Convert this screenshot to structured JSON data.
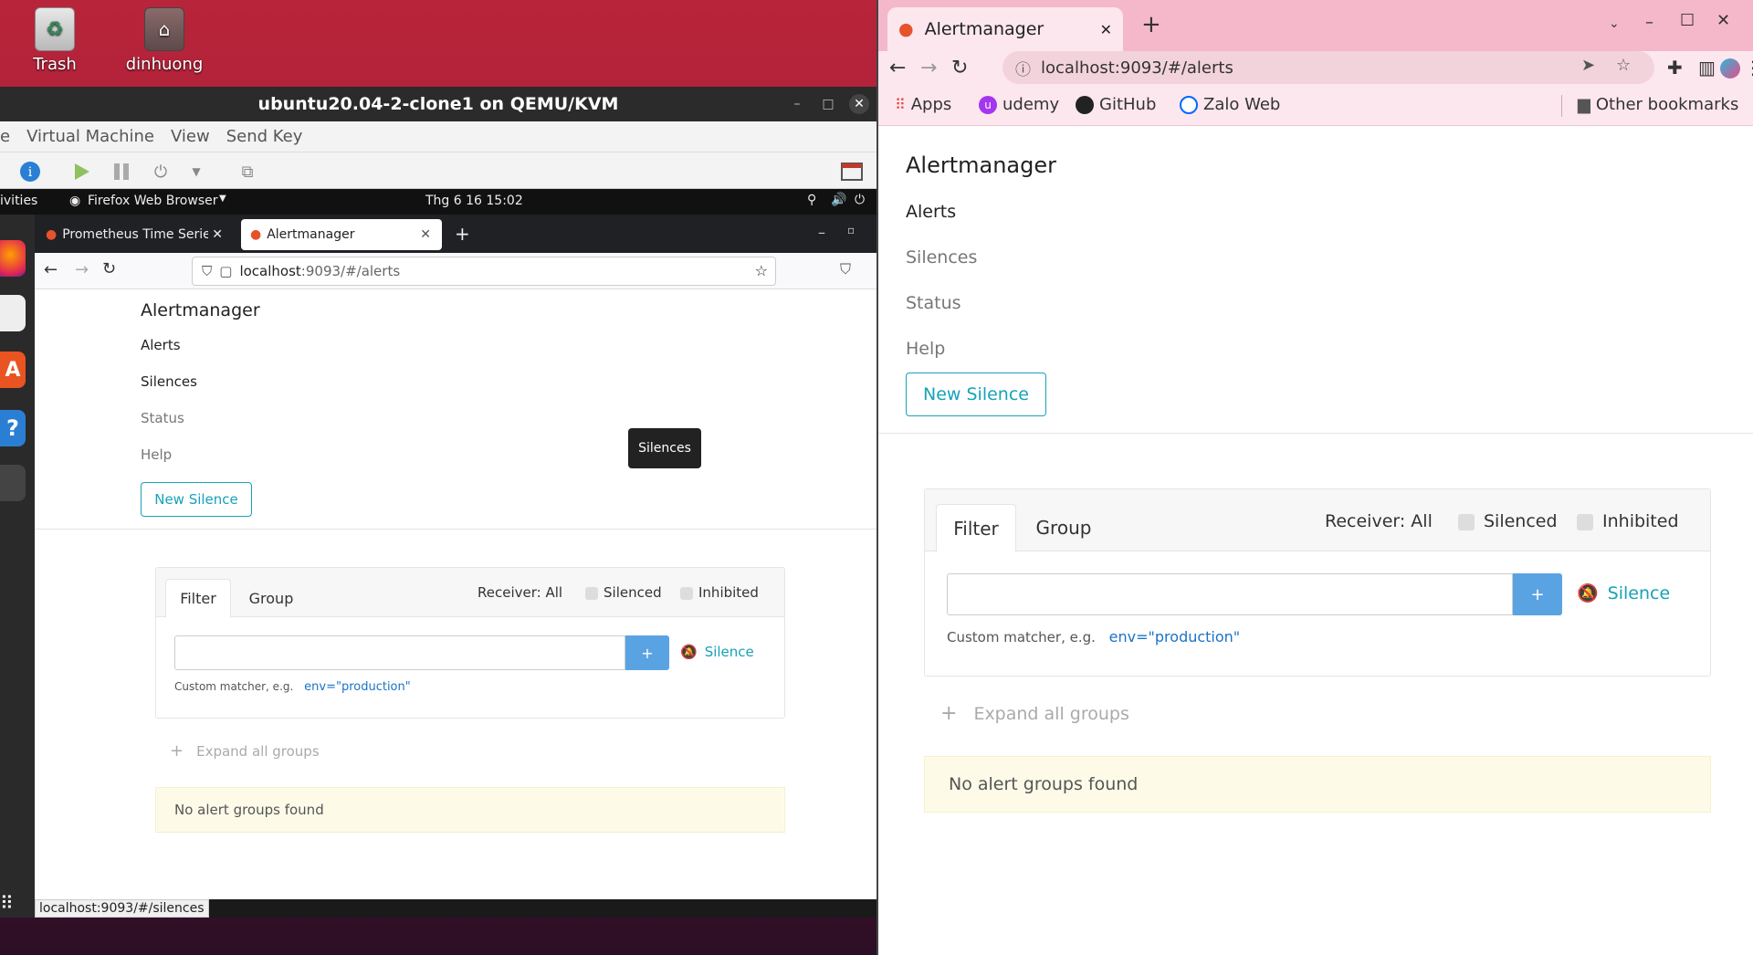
{
  "desktop": {
    "icons": [
      {
        "label": "Trash"
      },
      {
        "label": "dinhuong"
      }
    ]
  },
  "vm": {
    "title": "ubuntu20.04-2-clone1 on QEMU/KVM",
    "menu": [
      "e",
      "Virtual Machine",
      "View",
      "Send Key"
    ]
  },
  "guest": {
    "activities": "ivities",
    "app_menu": "Firefox Web Browser",
    "clock": "Thg 6 16  15:02"
  },
  "firefox": {
    "tabs": [
      {
        "label": "Prometheus Time Series"
      },
      {
        "label": "Alertmanager"
      }
    ],
    "url_host": "localhost",
    "url_rest": ":9093/#/alerts",
    "tooltip": "Silences",
    "status_url": "localhost:9093/#/silences"
  },
  "alertmanager": {
    "brand": "Alertmanager",
    "nav": [
      "Alerts",
      "Silences",
      "Status",
      "Help"
    ],
    "new_silence": "New Silence",
    "tabs": {
      "filter": "Filter",
      "group": "Group"
    },
    "receiver": "Receiver: All",
    "silenced": "Silenced",
    "inhibited": "Inhibited",
    "plus": "+",
    "silence_btn": "Silence",
    "custom_matcher": "Custom matcher, e.g.",
    "example": "env=\"production\"",
    "expand_all": "Expand all groups",
    "no_alerts": "No alert groups found"
  },
  "chrome": {
    "tab_title": "Alertmanager",
    "url": "localhost:9093/#/alerts",
    "bookmarks": [
      "Apps",
      "udemy",
      "GitHub",
      "Zalo Web"
    ],
    "other_bookmarks": "Other bookmarks"
  }
}
